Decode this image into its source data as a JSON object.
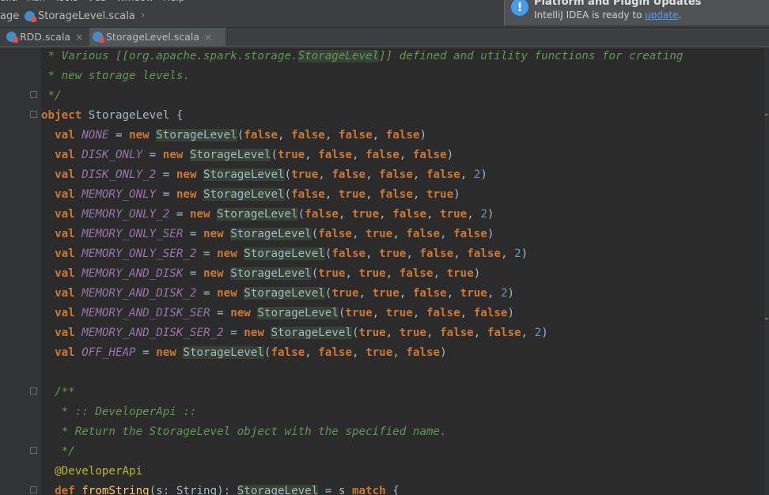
{
  "menubar": {
    "items": [
      "uild",
      "Run",
      "Tools",
      "VCS",
      "Window",
      "Help"
    ]
  },
  "breadcrumb": {
    "items": [
      "age",
      "StorageLevel.scala"
    ]
  },
  "tabs": [
    {
      "label": "RDD.scala",
      "active": false
    },
    {
      "label": "StorageLevel.scala",
      "active": true
    }
  ],
  "notification": {
    "title": "Platform and Plugin Updates",
    "body": "IntelliJ IDEA is ready to ",
    "link": "update",
    "trail": "."
  },
  "code_lines": [
    [
      [
        "cm",
        " * Various [["
      ],
      [
        "cm",
        "org.apache.spark.storage."
      ],
      [
        "cmref",
        "StorageLevel"
      ],
      [
        "cm",
        "]] defined and utility functions for creating"
      ]
    ],
    [
      [
        "cm",
        " * new storage levels."
      ]
    ],
    [
      [
        "cm",
        " */"
      ]
    ],
    [
      [
        "kw",
        "object"
      ],
      [
        "plain",
        " StorageLevel {"
      ]
    ],
    [
      [
        "plain",
        "  "
      ],
      [
        "kw",
        "val"
      ],
      [
        "plain",
        " "
      ],
      [
        "cst",
        "NONE"
      ],
      [
        "plain",
        " = "
      ],
      [
        "kw",
        "new"
      ],
      [
        "plain",
        " "
      ],
      [
        "tp",
        "StorageLevel"
      ],
      [
        "plain",
        "("
      ],
      [
        "kw",
        "false"
      ],
      [
        "plain",
        ", "
      ],
      [
        "kw",
        "false"
      ],
      [
        "plain",
        ", "
      ],
      [
        "kw",
        "false"
      ],
      [
        "plain",
        ", "
      ],
      [
        "kw",
        "false"
      ],
      [
        "plain",
        ")"
      ]
    ],
    [
      [
        "plain",
        "  "
      ],
      [
        "kw",
        "val"
      ],
      [
        "plain",
        " "
      ],
      [
        "cst",
        "DISK_ONLY"
      ],
      [
        "plain",
        " = "
      ],
      [
        "kw",
        "new"
      ],
      [
        "plain",
        " "
      ],
      [
        "tp",
        "StorageLevel"
      ],
      [
        "plain",
        "("
      ],
      [
        "kw",
        "true"
      ],
      [
        "plain",
        ", "
      ],
      [
        "kw",
        "false"
      ],
      [
        "plain",
        ", "
      ],
      [
        "kw",
        "false"
      ],
      [
        "plain",
        ", "
      ],
      [
        "kw",
        "false"
      ],
      [
        "plain",
        ")"
      ]
    ],
    [
      [
        "plain",
        "  "
      ],
      [
        "kw",
        "val"
      ],
      [
        "plain",
        " "
      ],
      [
        "cst",
        "DISK_ONLY_2"
      ],
      [
        "plain",
        " = "
      ],
      [
        "kw",
        "new"
      ],
      [
        "plain",
        " "
      ],
      [
        "tp",
        "StorageLevel"
      ],
      [
        "plain",
        "("
      ],
      [
        "kw",
        "true"
      ],
      [
        "plain",
        ", "
      ],
      [
        "kw",
        "false"
      ],
      [
        "plain",
        ", "
      ],
      [
        "kw",
        "false"
      ],
      [
        "plain",
        ", "
      ],
      [
        "kw",
        "false"
      ],
      [
        "plain",
        ", "
      ],
      [
        "num",
        "2"
      ],
      [
        "plain",
        ")"
      ]
    ],
    [
      [
        "plain",
        "  "
      ],
      [
        "kw",
        "val"
      ],
      [
        "plain",
        " "
      ],
      [
        "cst",
        "MEMORY_ONLY"
      ],
      [
        "plain",
        " = "
      ],
      [
        "kw",
        "new"
      ],
      [
        "plain",
        " "
      ],
      [
        "tp",
        "StorageLevel"
      ],
      [
        "plain",
        "("
      ],
      [
        "kw",
        "false"
      ],
      [
        "plain",
        ", "
      ],
      [
        "kw",
        "true"
      ],
      [
        "plain",
        ", "
      ],
      [
        "kw",
        "false"
      ],
      [
        "plain",
        ", "
      ],
      [
        "kw",
        "true"
      ],
      [
        "plain",
        ")"
      ]
    ],
    [
      [
        "plain",
        "  "
      ],
      [
        "kw",
        "val"
      ],
      [
        "plain",
        " "
      ],
      [
        "cst",
        "MEMORY_ONLY_2"
      ],
      [
        "plain",
        " = "
      ],
      [
        "kw",
        "new"
      ],
      [
        "plain",
        " "
      ],
      [
        "tp",
        "StorageLevel"
      ],
      [
        "plain",
        "("
      ],
      [
        "kw",
        "false"
      ],
      [
        "plain",
        ", "
      ],
      [
        "kw",
        "true"
      ],
      [
        "plain",
        ", "
      ],
      [
        "kw",
        "false"
      ],
      [
        "plain",
        ", "
      ],
      [
        "kw",
        "true"
      ],
      [
        "plain",
        ", "
      ],
      [
        "num",
        "2"
      ],
      [
        "plain",
        ")"
      ]
    ],
    [
      [
        "plain",
        "  "
      ],
      [
        "kw",
        "val"
      ],
      [
        "plain",
        " "
      ],
      [
        "cst",
        "MEMORY_ONLY_SER"
      ],
      [
        "plain",
        " = "
      ],
      [
        "kw",
        "new"
      ],
      [
        "plain",
        " "
      ],
      [
        "tp",
        "StorageLevel"
      ],
      [
        "plain",
        "("
      ],
      [
        "kw",
        "false"
      ],
      [
        "plain",
        ", "
      ],
      [
        "kw",
        "true"
      ],
      [
        "plain",
        ", "
      ],
      [
        "kw",
        "false"
      ],
      [
        "plain",
        ", "
      ],
      [
        "kw",
        "false"
      ],
      [
        "plain",
        ")"
      ]
    ],
    [
      [
        "plain",
        "  "
      ],
      [
        "kw",
        "val"
      ],
      [
        "plain",
        " "
      ],
      [
        "cst",
        "MEMORY_ONLY_SER_2"
      ],
      [
        "plain",
        " = "
      ],
      [
        "kw",
        "new"
      ],
      [
        "plain",
        " "
      ],
      [
        "tp",
        "StorageLevel"
      ],
      [
        "plain",
        "("
      ],
      [
        "kw",
        "false"
      ],
      [
        "plain",
        ", "
      ],
      [
        "kw",
        "true"
      ],
      [
        "plain",
        ", "
      ],
      [
        "kw",
        "false"
      ],
      [
        "plain",
        ", "
      ],
      [
        "kw",
        "false"
      ],
      [
        "plain",
        ", "
      ],
      [
        "num",
        "2"
      ],
      [
        "plain",
        ")"
      ]
    ],
    [
      [
        "plain",
        "  "
      ],
      [
        "kw",
        "val"
      ],
      [
        "plain",
        " "
      ],
      [
        "cst",
        "MEMORY_AND_DISK"
      ],
      [
        "plain",
        " = "
      ],
      [
        "kw",
        "new"
      ],
      [
        "plain",
        " "
      ],
      [
        "tp",
        "StorageLevel"
      ],
      [
        "plain",
        "("
      ],
      [
        "kw",
        "true"
      ],
      [
        "plain",
        ", "
      ],
      [
        "kw",
        "true"
      ],
      [
        "plain",
        ", "
      ],
      [
        "kw",
        "false"
      ],
      [
        "plain",
        ", "
      ],
      [
        "kw",
        "true"
      ],
      [
        "plain",
        ")"
      ]
    ],
    [
      [
        "plain",
        "  "
      ],
      [
        "kw",
        "val"
      ],
      [
        "plain",
        " "
      ],
      [
        "cst",
        "MEMORY_AND_DISK_2"
      ],
      [
        "plain",
        " = "
      ],
      [
        "kw",
        "new"
      ],
      [
        "plain",
        " "
      ],
      [
        "tp",
        "StorageLevel"
      ],
      [
        "plain",
        "("
      ],
      [
        "kw",
        "true"
      ],
      [
        "plain",
        ", "
      ],
      [
        "kw",
        "true"
      ],
      [
        "plain",
        ", "
      ],
      [
        "kw",
        "false"
      ],
      [
        "plain",
        ", "
      ],
      [
        "kw",
        "true"
      ],
      [
        "plain",
        ", "
      ],
      [
        "num",
        "2"
      ],
      [
        "plain",
        ")"
      ]
    ],
    [
      [
        "plain",
        "  "
      ],
      [
        "kw",
        "val"
      ],
      [
        "plain",
        " "
      ],
      [
        "cst",
        "MEMORY_AND_DISK_SER"
      ],
      [
        "plain",
        " = "
      ],
      [
        "kw",
        "new"
      ],
      [
        "plain",
        " "
      ],
      [
        "tp",
        "StorageLevel"
      ],
      [
        "plain",
        "("
      ],
      [
        "kw",
        "true"
      ],
      [
        "plain",
        ", "
      ],
      [
        "kw",
        "true"
      ],
      [
        "plain",
        ", "
      ],
      [
        "kw",
        "false"
      ],
      [
        "plain",
        ", "
      ],
      [
        "kw",
        "false"
      ],
      [
        "plain",
        ")"
      ]
    ],
    [
      [
        "plain",
        "  "
      ],
      [
        "kw",
        "val"
      ],
      [
        "plain",
        " "
      ],
      [
        "cst",
        "MEMORY_AND_DISK_SER_2"
      ],
      [
        "plain",
        " = "
      ],
      [
        "kw",
        "new"
      ],
      [
        "plain",
        " "
      ],
      [
        "tp",
        "StorageLevel"
      ],
      [
        "plain",
        "("
      ],
      [
        "kw",
        "true"
      ],
      [
        "plain",
        ", "
      ],
      [
        "kw",
        "true"
      ],
      [
        "plain",
        ", "
      ],
      [
        "kw",
        "false"
      ],
      [
        "plain",
        ", "
      ],
      [
        "kw",
        "false"
      ],
      [
        "plain",
        ", "
      ],
      [
        "num",
        "2"
      ],
      [
        "plain",
        ")"
      ]
    ],
    [
      [
        "plain",
        "  "
      ],
      [
        "kw",
        "val"
      ],
      [
        "plain",
        " "
      ],
      [
        "cst",
        "OFF_HEAP"
      ],
      [
        "plain",
        " = "
      ],
      [
        "kw",
        "new"
      ],
      [
        "plain",
        " "
      ],
      [
        "tp",
        "StorageLevel"
      ],
      [
        "plain",
        "("
      ],
      [
        "kw",
        "false"
      ],
      [
        "plain",
        ", "
      ],
      [
        "kw",
        "false"
      ],
      [
        "plain",
        ", "
      ],
      [
        "kw",
        "true"
      ],
      [
        "plain",
        ", "
      ],
      [
        "kw",
        "false"
      ],
      [
        "plain",
        ")"
      ]
    ],
    [],
    [
      [
        "cm",
        "  /**"
      ]
    ],
    [
      [
        "cm",
        "   * :: DeveloperApi ::"
      ]
    ],
    [
      [
        "cm",
        "   * Return the StorageLevel object with the specified name."
      ]
    ],
    [
      [
        "cm",
        "   */"
      ]
    ],
    [
      [
        "ann",
        "  @DeveloperApi"
      ]
    ],
    [
      [
        "plain",
        "  "
      ],
      [
        "kw",
        "def"
      ],
      [
        "plain",
        " "
      ],
      [
        "fn",
        "fromString"
      ],
      [
        "plain",
        "(s: "
      ],
      [
        "typ",
        "String"
      ],
      [
        "plain",
        "): "
      ],
      [
        "tp",
        "StorageLevel"
      ],
      [
        "plain",
        " = s "
      ],
      [
        "kw",
        "match"
      ],
      [
        "plain",
        " {"
      ]
    ]
  ]
}
